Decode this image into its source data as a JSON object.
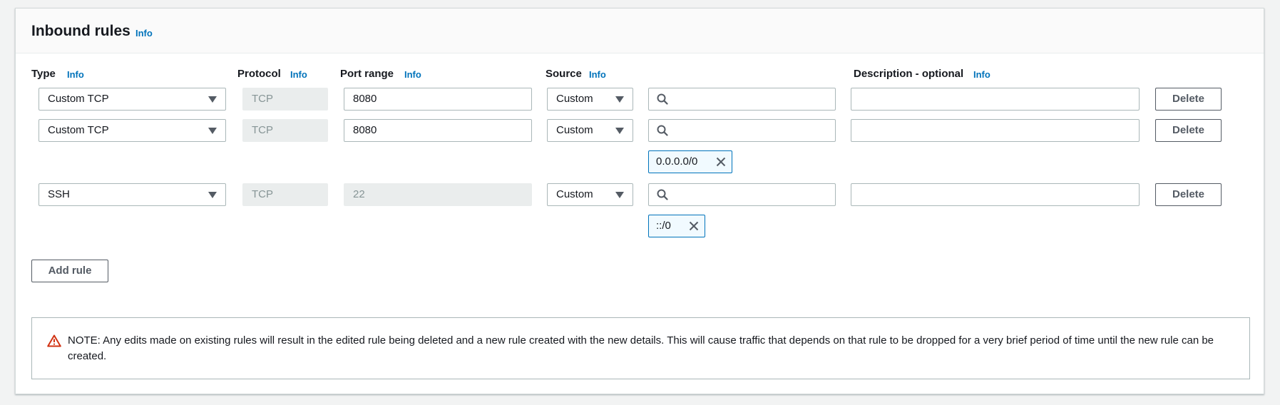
{
  "header": {
    "title": "Inbound rules",
    "info": "Info"
  },
  "columns": {
    "type": "Type",
    "protocol": "Protocol",
    "port_range": "Port range",
    "source": "Source",
    "description": "Description - optional",
    "info": "Info"
  },
  "rules": [
    {
      "type": "Custom TCP",
      "protocol": "TCP",
      "port": "8080",
      "source": "Custom",
      "cidr": "",
      "description": "",
      "delete": "Delete"
    },
    {
      "type": "Custom TCP",
      "protocol": "TCP",
      "port": "8080",
      "source": "Custom",
      "cidr": "0.0.0.0/0",
      "description": "",
      "delete": "Delete"
    },
    {
      "type": "SSH",
      "protocol": "TCP",
      "port": "22",
      "source": "Custom",
      "cidr": "::/0",
      "description": "",
      "delete": "Delete"
    }
  ],
  "add_rule": "Add rule",
  "alert": {
    "icon": "warning-triangle-icon",
    "message": "NOTE: Any edits made on existing rules will result in the edited rule being deleted and a new rule created with the new details. This will cause traffic that depends on that rule to be dropped for a very brief period of time until the new rule can be created."
  },
  "colors": {
    "link": "#0073bb",
    "warning": "#d13212",
    "token_border": "#0073bb"
  }
}
